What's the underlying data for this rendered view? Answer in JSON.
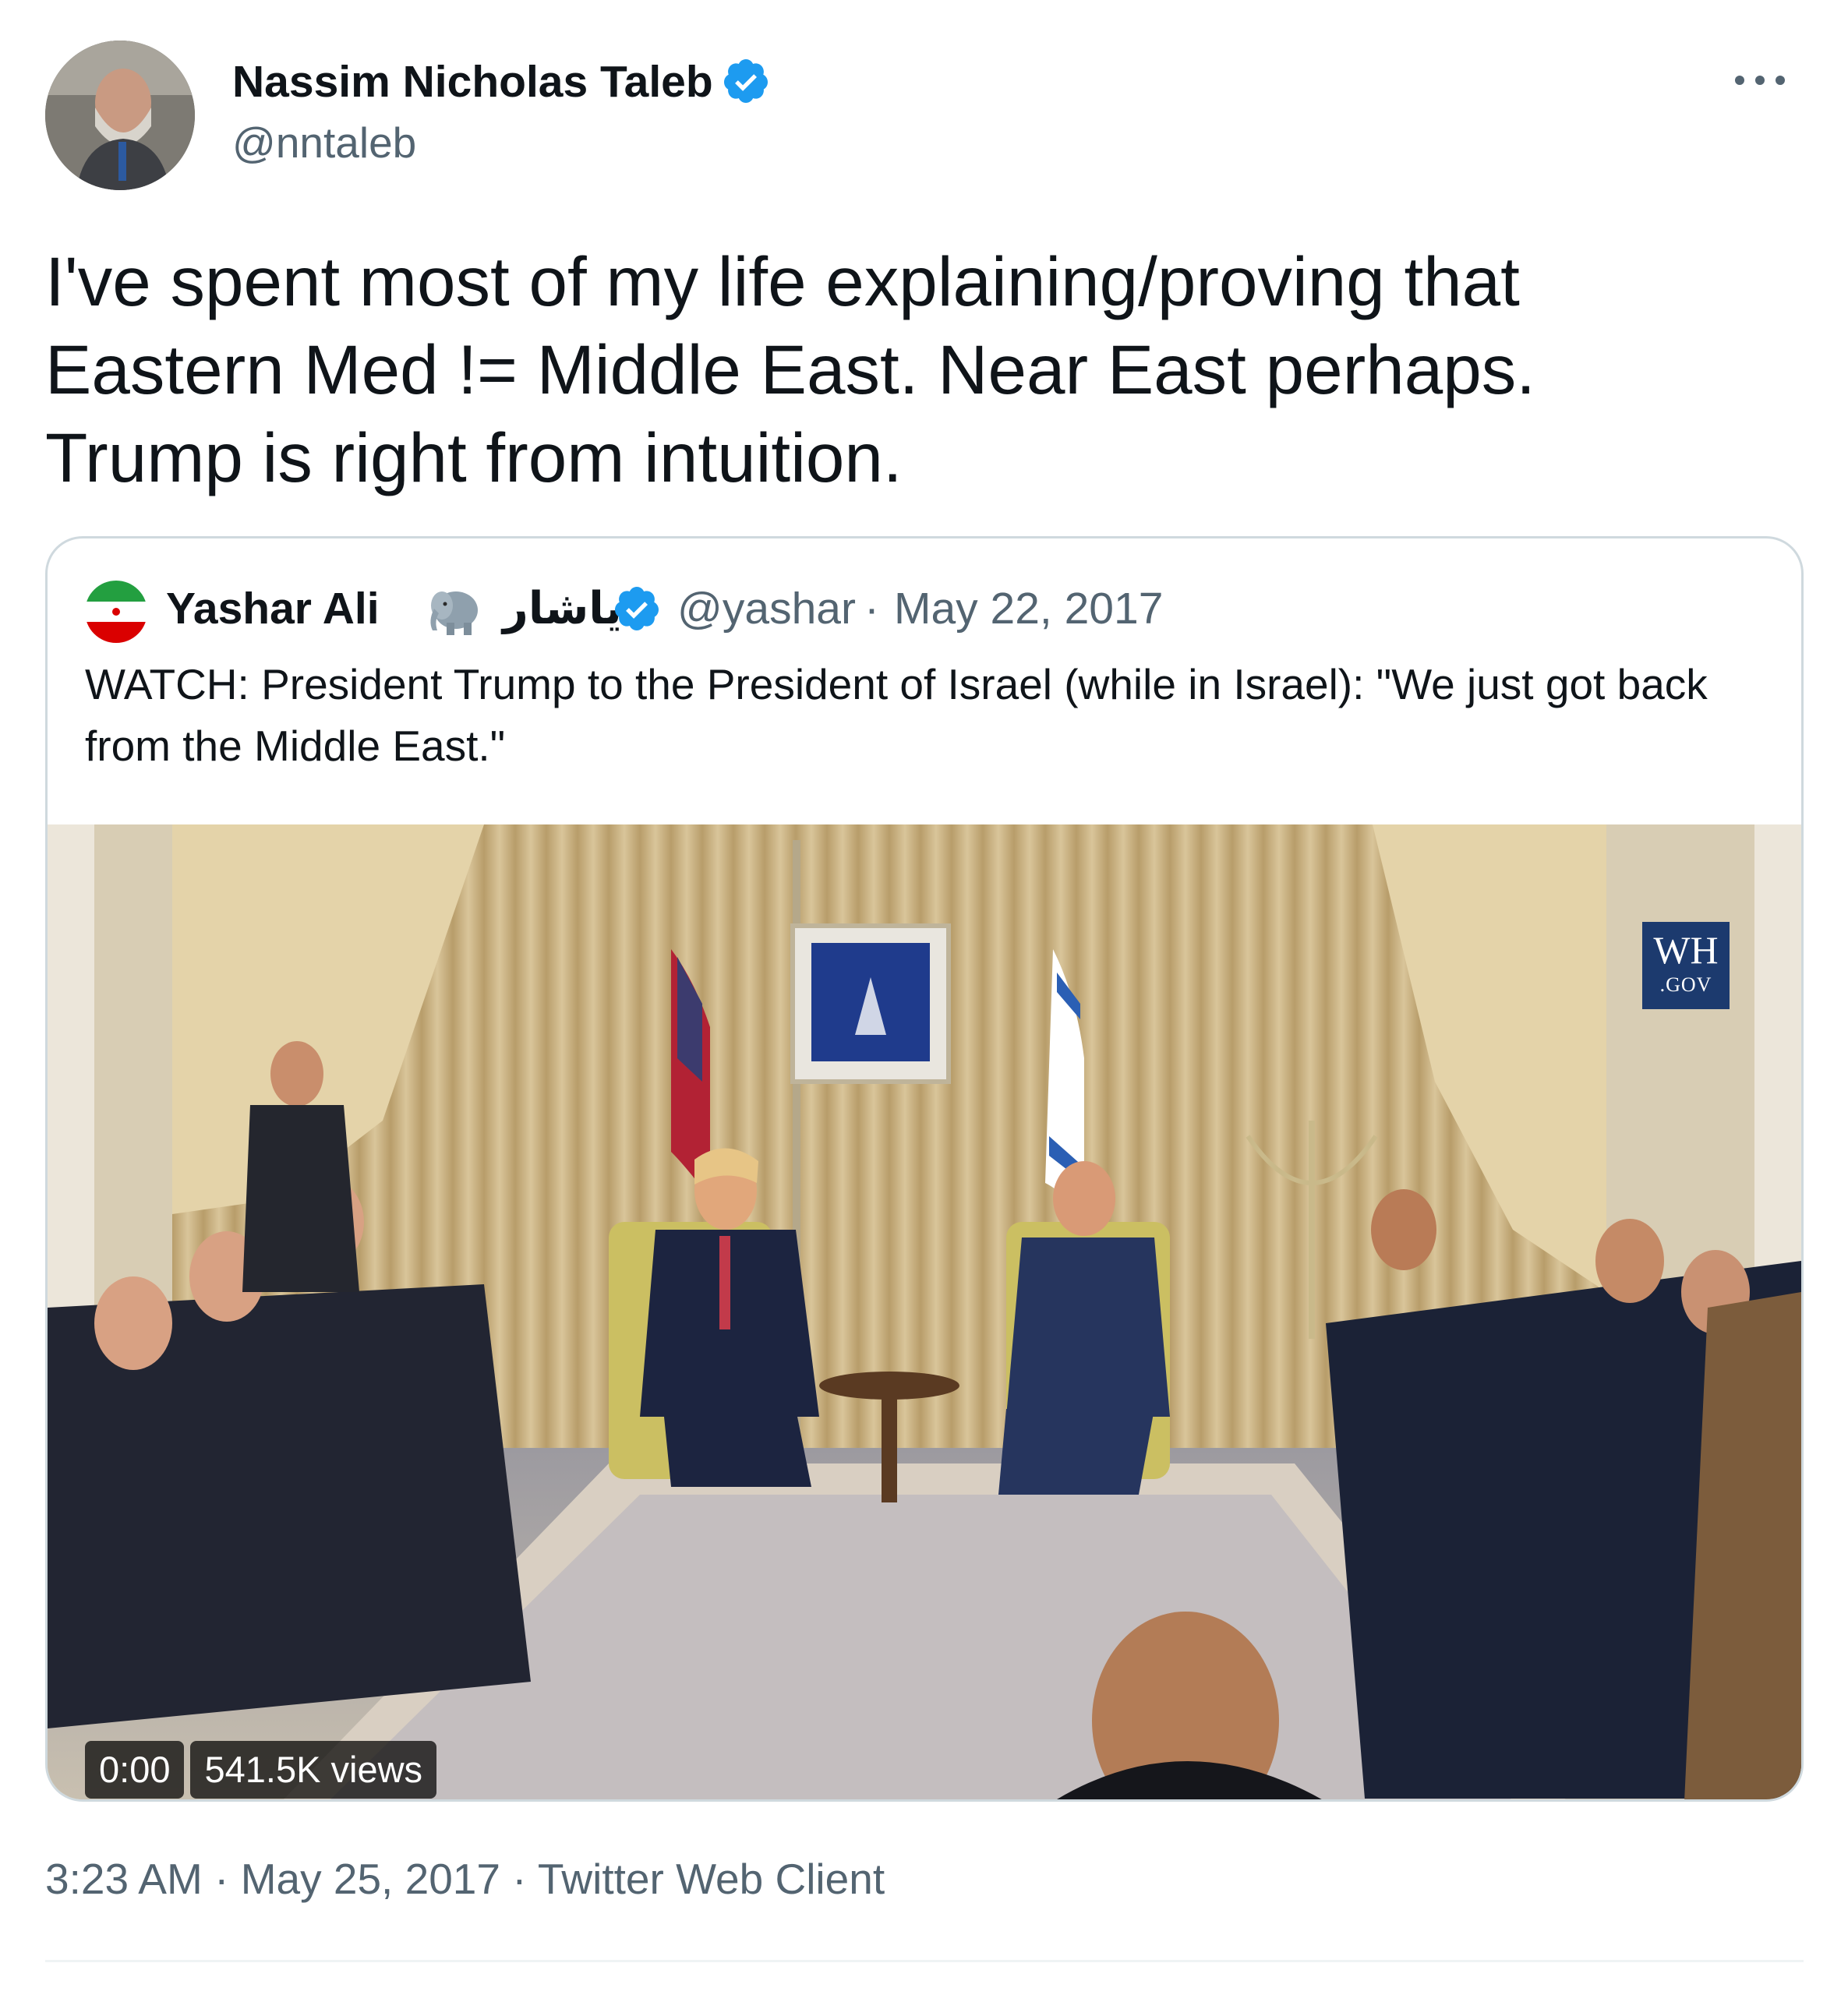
{
  "tweet": {
    "author": {
      "name": "Nassim Nicholas Taleb",
      "handle": "@nntaleb",
      "verified": true,
      "avatar_icon": "avatar-photo"
    },
    "text": "I've spent most of my life explaining/proving that\nEastern Med != Middle East. Near East perhaps.\nTrump is right from intuition.",
    "timestamp": "3:23 AM",
    "date": "May 25, 2017",
    "client": "Twitter Web Client",
    "separator": "·"
  },
  "quoted": {
    "name": "Yashar Ali",
    "emoji_icon": "elephant-icon",
    "arabic_name": "یاشار",
    "verified": true,
    "handle": "@yashar",
    "separator": "·",
    "date": "May 22, 2017",
    "text": "WATCH: President Trump to the President of Israel (while in Israel): \"We just got back from the Middle East.\"",
    "video": {
      "time": "0:00",
      "views": "541.5K views",
      "watermark_top": "WH",
      "watermark_bottom": ".GOV"
    }
  },
  "colors": {
    "text_primary": "#0f1419",
    "text_secondary": "#536471",
    "verified_blue": "#1d9bf0",
    "border": "#cfd9de"
  }
}
